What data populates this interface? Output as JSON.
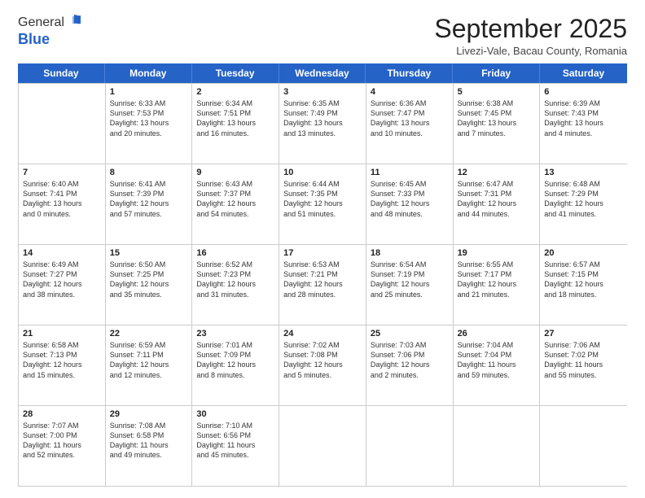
{
  "logo": {
    "general": "General",
    "blue": "Blue"
  },
  "title": "September 2025",
  "location": "Livezi-Vale, Bacau County, Romania",
  "header_days": [
    "Sunday",
    "Monday",
    "Tuesday",
    "Wednesday",
    "Thursday",
    "Friday",
    "Saturday"
  ],
  "weeks": [
    [
      {
        "day": "",
        "info": ""
      },
      {
        "day": "1",
        "info": "Sunrise: 6:33 AM\nSunset: 7:53 PM\nDaylight: 13 hours\nand 20 minutes."
      },
      {
        "day": "2",
        "info": "Sunrise: 6:34 AM\nSunset: 7:51 PM\nDaylight: 13 hours\nand 16 minutes."
      },
      {
        "day": "3",
        "info": "Sunrise: 6:35 AM\nSunset: 7:49 PM\nDaylight: 13 hours\nand 13 minutes."
      },
      {
        "day": "4",
        "info": "Sunrise: 6:36 AM\nSunset: 7:47 PM\nDaylight: 13 hours\nand 10 minutes."
      },
      {
        "day": "5",
        "info": "Sunrise: 6:38 AM\nSunset: 7:45 PM\nDaylight: 13 hours\nand 7 minutes."
      },
      {
        "day": "6",
        "info": "Sunrise: 6:39 AM\nSunset: 7:43 PM\nDaylight: 13 hours\nand 4 minutes."
      }
    ],
    [
      {
        "day": "7",
        "info": "Sunrise: 6:40 AM\nSunset: 7:41 PM\nDaylight: 13 hours\nand 0 minutes."
      },
      {
        "day": "8",
        "info": "Sunrise: 6:41 AM\nSunset: 7:39 PM\nDaylight: 12 hours\nand 57 minutes."
      },
      {
        "day": "9",
        "info": "Sunrise: 6:43 AM\nSunset: 7:37 PM\nDaylight: 12 hours\nand 54 minutes."
      },
      {
        "day": "10",
        "info": "Sunrise: 6:44 AM\nSunset: 7:35 PM\nDaylight: 12 hours\nand 51 minutes."
      },
      {
        "day": "11",
        "info": "Sunrise: 6:45 AM\nSunset: 7:33 PM\nDaylight: 12 hours\nand 48 minutes."
      },
      {
        "day": "12",
        "info": "Sunrise: 6:47 AM\nSunset: 7:31 PM\nDaylight: 12 hours\nand 44 minutes."
      },
      {
        "day": "13",
        "info": "Sunrise: 6:48 AM\nSunset: 7:29 PM\nDaylight: 12 hours\nand 41 minutes."
      }
    ],
    [
      {
        "day": "14",
        "info": "Sunrise: 6:49 AM\nSunset: 7:27 PM\nDaylight: 12 hours\nand 38 minutes."
      },
      {
        "day": "15",
        "info": "Sunrise: 6:50 AM\nSunset: 7:25 PM\nDaylight: 12 hours\nand 35 minutes."
      },
      {
        "day": "16",
        "info": "Sunrise: 6:52 AM\nSunset: 7:23 PM\nDaylight: 12 hours\nand 31 minutes."
      },
      {
        "day": "17",
        "info": "Sunrise: 6:53 AM\nSunset: 7:21 PM\nDaylight: 12 hours\nand 28 minutes."
      },
      {
        "day": "18",
        "info": "Sunrise: 6:54 AM\nSunset: 7:19 PM\nDaylight: 12 hours\nand 25 minutes."
      },
      {
        "day": "19",
        "info": "Sunrise: 6:55 AM\nSunset: 7:17 PM\nDaylight: 12 hours\nand 21 minutes."
      },
      {
        "day": "20",
        "info": "Sunrise: 6:57 AM\nSunset: 7:15 PM\nDaylight: 12 hours\nand 18 minutes."
      }
    ],
    [
      {
        "day": "21",
        "info": "Sunrise: 6:58 AM\nSunset: 7:13 PM\nDaylight: 12 hours\nand 15 minutes."
      },
      {
        "day": "22",
        "info": "Sunrise: 6:59 AM\nSunset: 7:11 PM\nDaylight: 12 hours\nand 12 minutes."
      },
      {
        "day": "23",
        "info": "Sunrise: 7:01 AM\nSunset: 7:09 PM\nDaylight: 12 hours\nand 8 minutes."
      },
      {
        "day": "24",
        "info": "Sunrise: 7:02 AM\nSunset: 7:08 PM\nDaylight: 12 hours\nand 5 minutes."
      },
      {
        "day": "25",
        "info": "Sunrise: 7:03 AM\nSunset: 7:06 PM\nDaylight: 12 hours\nand 2 minutes."
      },
      {
        "day": "26",
        "info": "Sunrise: 7:04 AM\nSunset: 7:04 PM\nDaylight: 11 hours\nand 59 minutes."
      },
      {
        "day": "27",
        "info": "Sunrise: 7:06 AM\nSunset: 7:02 PM\nDaylight: 11 hours\nand 55 minutes."
      }
    ],
    [
      {
        "day": "28",
        "info": "Sunrise: 7:07 AM\nSunset: 7:00 PM\nDaylight: 11 hours\nand 52 minutes."
      },
      {
        "day": "29",
        "info": "Sunrise: 7:08 AM\nSunset: 6:58 PM\nDaylight: 11 hours\nand 49 minutes."
      },
      {
        "day": "30",
        "info": "Sunrise: 7:10 AM\nSunset: 6:56 PM\nDaylight: 11 hours\nand 45 minutes."
      },
      {
        "day": "",
        "info": ""
      },
      {
        "day": "",
        "info": ""
      },
      {
        "day": "",
        "info": ""
      },
      {
        "day": "",
        "info": ""
      }
    ]
  ]
}
